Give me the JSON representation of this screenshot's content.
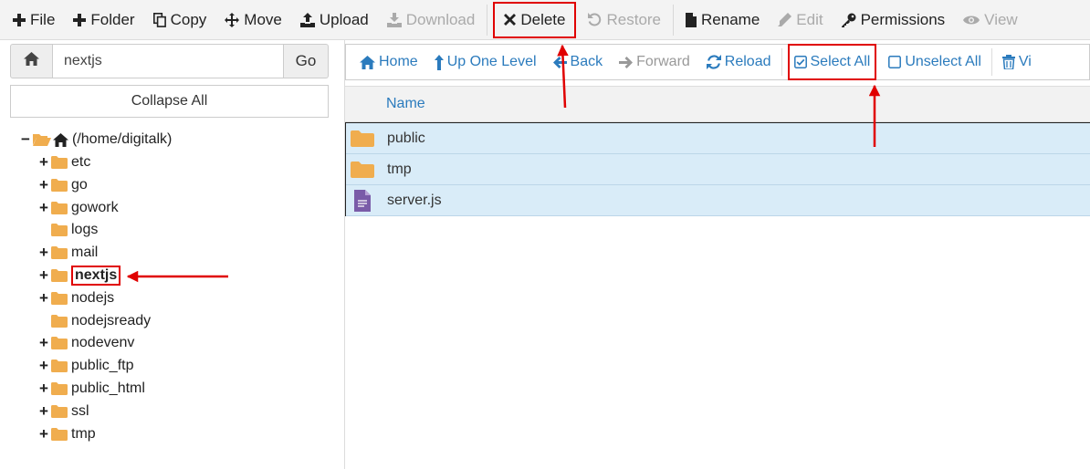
{
  "toolbar": {
    "file": "File",
    "folder": "Folder",
    "copy": "Copy",
    "move": "Move",
    "upload": "Upload",
    "download": "Download",
    "delete": "Delete",
    "restore": "Restore",
    "rename": "Rename",
    "edit": "Edit",
    "permissions": "Permissions",
    "view": "View"
  },
  "sidebar": {
    "path_value": "nextjs",
    "go_label": "Go",
    "collapse_label": "Collapse All",
    "root_label": "(/home/digitalk)",
    "items": [
      {
        "label": "etc",
        "toggle": "+"
      },
      {
        "label": "go",
        "toggle": "+"
      },
      {
        "label": "gowork",
        "toggle": "+"
      },
      {
        "label": "logs",
        "toggle": ""
      },
      {
        "label": "mail",
        "toggle": "+"
      },
      {
        "label": "nextjs",
        "toggle": "+"
      },
      {
        "label": "nodejs",
        "toggle": "+"
      },
      {
        "label": "nodejsready",
        "toggle": ""
      },
      {
        "label": "nodevenv",
        "toggle": "+"
      },
      {
        "label": "public_ftp",
        "toggle": "+"
      },
      {
        "label": "public_html",
        "toggle": "+"
      },
      {
        "label": "ssl",
        "toggle": "+"
      },
      {
        "label": "tmp",
        "toggle": "+"
      }
    ],
    "root_toggle": "−"
  },
  "nav": {
    "home": "Home",
    "up": "Up One Level",
    "back": "Back",
    "forward": "Forward",
    "reload": "Reload",
    "select_all": "Select All",
    "unselect_all": "Unselect All",
    "view_trash": "Vi"
  },
  "files": {
    "header_name": "Name",
    "rows": [
      {
        "name": "public",
        "type": "folder"
      },
      {
        "name": "tmp",
        "type": "folder"
      },
      {
        "name": "server.js",
        "type": "file"
      }
    ]
  },
  "colors": {
    "accent": "#2b7bbd",
    "folder": "#f0ad4e",
    "highlight": "#e00000",
    "selected_row": "#d9ecf8"
  }
}
